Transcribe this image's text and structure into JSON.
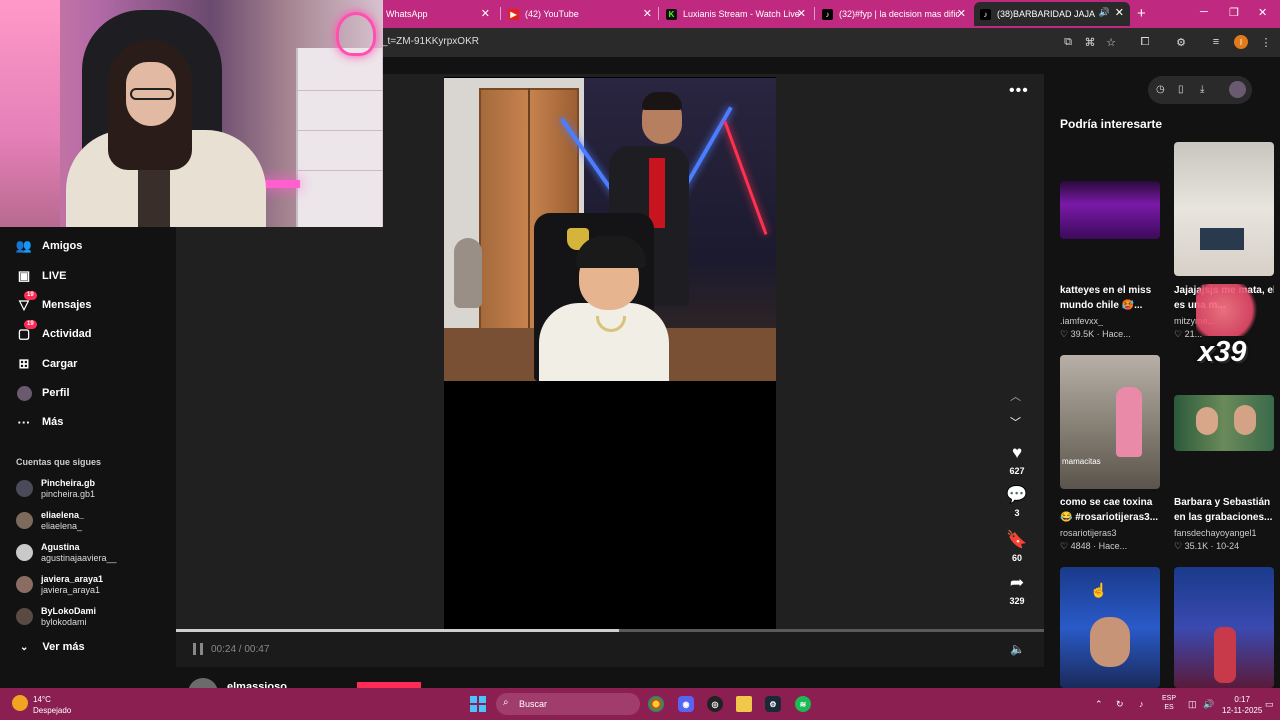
{
  "browser": {
    "tabs": [
      {
        "title": "WhatsApp",
        "favicon": "whatsapp-icon"
      },
      {
        "title": "(42) YouTube",
        "favicon": "youtube-icon"
      },
      {
        "title": "Luxianis Stream - Watch Live o",
        "favicon": "kick-icon"
      },
      {
        "title": "(32)#fyp | la decision mas difici",
        "favicon": "tiktok-icon"
      },
      {
        "title": "(38)BARBARIDAD JAJA @e",
        "favicon": "tiktok-icon",
        "active": true
      }
    ],
    "new_tab": "+",
    "url": "_t=ZM-91KKyrpxOKR",
    "profile_initial": "I",
    "colors": {
      "tabbar": "#bf2a80",
      "toolbar": "#2a2a2a"
    }
  },
  "sidebar": {
    "nav": [
      {
        "label": "Amigos",
        "icon": "friends-icon"
      },
      {
        "label": "LIVE",
        "icon": "live-icon"
      },
      {
        "label": "Mensajes",
        "icon": "messages-icon",
        "badge": "19"
      },
      {
        "label": "Actividad",
        "icon": "activity-icon",
        "badge": "19"
      },
      {
        "label": "Cargar",
        "icon": "upload-icon"
      },
      {
        "label": "Perfil",
        "icon": "profile-icon"
      },
      {
        "label": "Más",
        "icon": "more-icon"
      }
    ],
    "following_title": "Cuentas que sigues",
    "following": [
      {
        "name": "Pincheira.gb",
        "handle": "pincheira.gb1"
      },
      {
        "name": "eliaelena_",
        "handle": "eliaelena_"
      },
      {
        "name": "Agustina",
        "handle": "agustinajaaviera__"
      },
      {
        "name": "javiera_araya1",
        "handle": "javiera_araya1"
      },
      {
        "name": "ByLokoDami",
        "handle": "bylokodami"
      }
    ],
    "see_more": "Ver más"
  },
  "player": {
    "actions": [
      {
        "icon": "heart-icon",
        "count": "627"
      },
      {
        "icon": "comment-icon",
        "count": "3"
      },
      {
        "icon": "bookmark-icon",
        "count": "60"
      },
      {
        "icon": "share-icon",
        "count": "329"
      }
    ],
    "time": "00:24 / 00:47",
    "progress": 0.51,
    "author": "elmassioso"
  },
  "recommendations": {
    "title": "Podría interesarte",
    "cards": [
      {
        "title": "katteyes en el miss",
        "title2": "mundo chile 🥵...",
        "user": ".iamfevxx_",
        "meta": "♡ 39.5K · Hace..."
      },
      {
        "title": "Jajajajsjs me mata, el",
        "title2": "es una m...",
        "user": "mitzyme...",
        "meta": "♡ 21..."
      },
      {
        "title": "como se cae toxina",
        "title2": "😂 #rosariotijeras3...",
        "user": "rosariotijeras3",
        "meta": "♡ 4848 · Hace..."
      },
      {
        "title": "Barbara y Sebastián",
        "title2": "en las grabaciones...",
        "user": "fansdechayoyangel1",
        "meta": "♡ 35.1K · 10-24"
      }
    ],
    "overlay_text": "x39",
    "thumb_caption": "mamacitas"
  },
  "taskbar": {
    "weather_temp": "14°C",
    "weather_desc": "Despejado",
    "search_placeholder": "Buscar",
    "lang_top": "ESP",
    "lang_bottom": "ES",
    "time": "0:17",
    "date": "12-11-2025"
  }
}
